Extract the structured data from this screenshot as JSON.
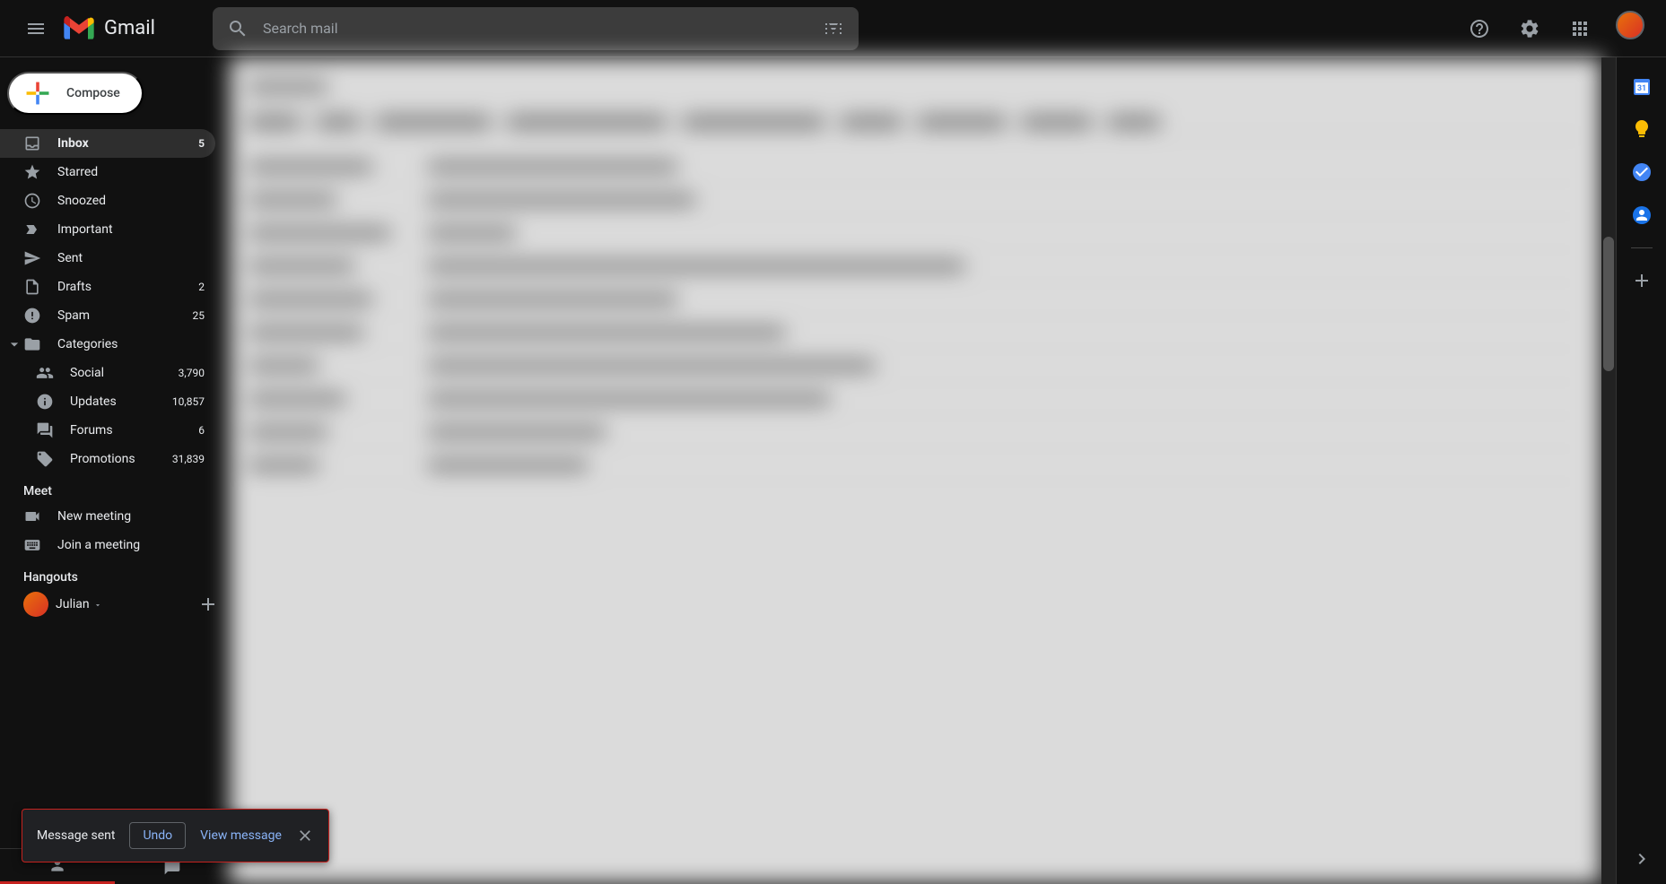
{
  "header": {
    "logo_text": "Gmail",
    "search_placeholder": "Search mail"
  },
  "compose": {
    "label": "Compose"
  },
  "nav": [
    {
      "icon": "inbox",
      "label": "Inbox",
      "count": "5",
      "selected": true
    },
    {
      "icon": "star",
      "label": "Starred",
      "count": ""
    },
    {
      "icon": "snooze",
      "label": "Snoozed",
      "count": ""
    },
    {
      "icon": "important",
      "label": "Important",
      "count": ""
    },
    {
      "icon": "sent",
      "label": "Sent",
      "count": ""
    },
    {
      "icon": "drafts",
      "label": "Drafts",
      "count": "2"
    },
    {
      "icon": "spam",
      "label": "Spam",
      "count": "25"
    },
    {
      "icon": "categories",
      "label": "Categories",
      "count": "",
      "expandable": true
    }
  ],
  "categories": [
    {
      "icon": "social",
      "label": "Social",
      "count": "3,790"
    },
    {
      "icon": "updates",
      "label": "Updates",
      "count": "10,857"
    },
    {
      "icon": "forums",
      "label": "Forums",
      "count": "6"
    },
    {
      "icon": "promotions",
      "label": "Promotions",
      "count": "31,839"
    }
  ],
  "meet": {
    "header": "Meet",
    "items": [
      {
        "label": "New meeting"
      },
      {
        "label": "Join a meeting"
      }
    ]
  },
  "hangouts": {
    "header": "Hangouts",
    "user": "Julian"
  },
  "toast": {
    "message": "Message sent",
    "undo": "Undo",
    "view": "View message"
  },
  "right_panel": {
    "icons": [
      "calendar",
      "keep",
      "tasks",
      "contacts"
    ]
  }
}
